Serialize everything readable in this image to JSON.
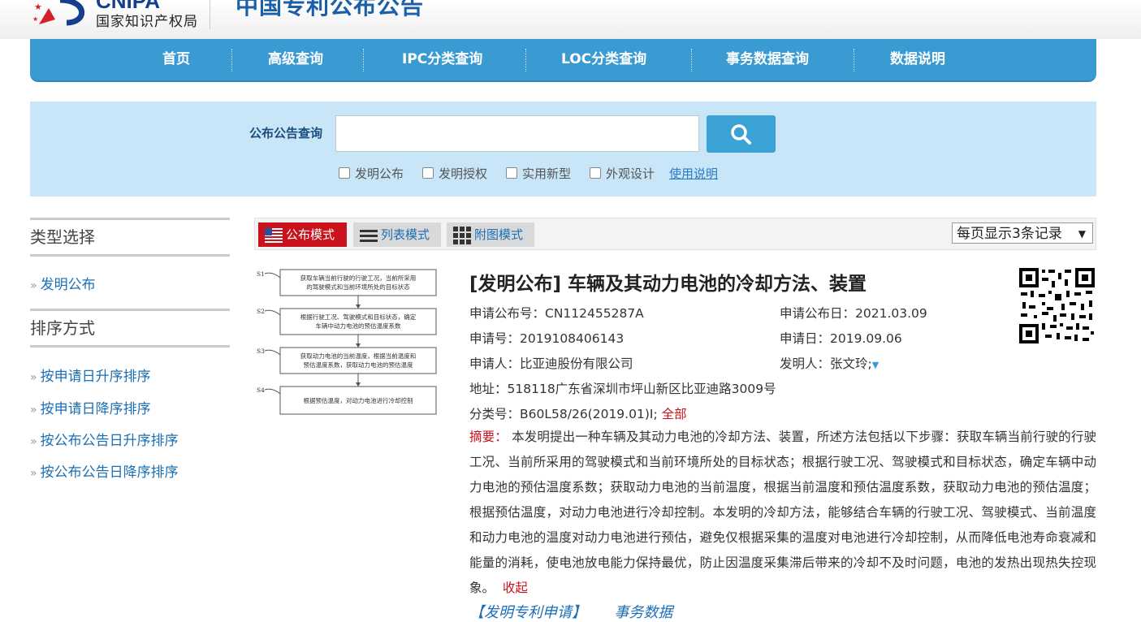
{
  "header": {
    "logo_en": "CNIPA",
    "logo_cn": "国家知识产权局",
    "site_title": "中国专利公布公告"
  },
  "nav": [
    "首页",
    "高级查询",
    "IPC分类查询",
    "LOC分类查询",
    "事务数据查询",
    "数据说明"
  ],
  "search": {
    "label": "公布公告查询",
    "value": "",
    "filters": [
      "发明公布",
      "发明授权",
      "实用新型",
      "外观设计"
    ],
    "help_link": "使用说明"
  },
  "sidebar": {
    "type_heading": "类型选择",
    "type_items": [
      "发明公布"
    ],
    "sort_heading": "排序方式",
    "sort_items": [
      "按申请日升序排序",
      "按申请日降序排序",
      "按公布公告日升序排序",
      "按公布公告日降序排序"
    ]
  },
  "toolbar": {
    "modes": [
      "公布模式",
      "列表模式",
      "附图模式"
    ],
    "active_mode": "公布模式",
    "per_page": "每页显示3条记录"
  },
  "figure": {
    "steps": [
      {
        "label": "S1",
        "text1": "获取车辆当前行驶的行驶工况，当前所采用",
        "text2": "的驾驶模式和当前环境所处的目标状态"
      },
      {
        "label": "S2",
        "text1": "根据行驶工况、驾驶模式和目标状态，确定",
        "text2": "车辆中动力电池的预估温度系数"
      },
      {
        "label": "S3",
        "text1": "获取动力电池的当前温度，根据当前温度和",
        "text2": "预估温度系数，获取动力电池的预估温度"
      },
      {
        "label": "S4",
        "text1": "根据预估温度，对动力电池进行冷却控制",
        "text2": ""
      }
    ]
  },
  "result": {
    "title": "[发明公布] 车辆及其动力电池的冷却方法、装置",
    "pub_no_label": "申请公布号：",
    "pub_no": "CN112455287A",
    "pub_date_label": "申请公布日：",
    "pub_date": "2021.03.09",
    "app_no_label": "申请号：",
    "app_no": "2019108406143",
    "app_date_label": "申请日：",
    "app_date": "2019.09.06",
    "applicant_label": "申请人：",
    "applicant": "比亚迪股份有限公司",
    "inventor_label": "发明人：",
    "inventor": "张文玲;",
    "address_label": "地址：",
    "address": "518118广东省深圳市坪山新区比亚迪路3009号",
    "class_label": "分类号：",
    "class_no": "B60L58/26(2019.01)I;",
    "class_all": "全部",
    "abstract_label": "摘要：",
    "abstract": "本发明提出一种车辆及其动力电池的冷却方法、装置，所述方法包括以下步骤：获取车辆当前行驶的行驶工况、当前所采用的驾驶模式和当前环境所处的目标状态；根据行驶工况、驾驶模式和目标状态，确定车辆中动力电池的预估温度系数；获取动力电池的当前温度，根据当前温度和预估温度系数，获取动力电池的预估温度；根据预估温度，对动力电池进行冷却控制。本发明的冷却方法，能够结合车辆的行驶工况、驾驶模式、当前温度和动力电池的温度对动力电池进行预估，避免仅根据采集的温度对电池进行冷却控制，从而降低电池寿命衰减和能量的消耗，使电池放电能力保持最优，防止因温度采集滞后带来的冷却不及时问题，电池的发热出现热失控现象。",
    "collapse": "收起",
    "link_patent": "【发明专利申请】",
    "link_transaction": "事务数据"
  },
  "colors": {
    "nav_bg": "#3a9ad2",
    "search_bg": "#c8e6f8",
    "accent_red": "#c9121b",
    "link_blue": "#1b6fb5"
  }
}
